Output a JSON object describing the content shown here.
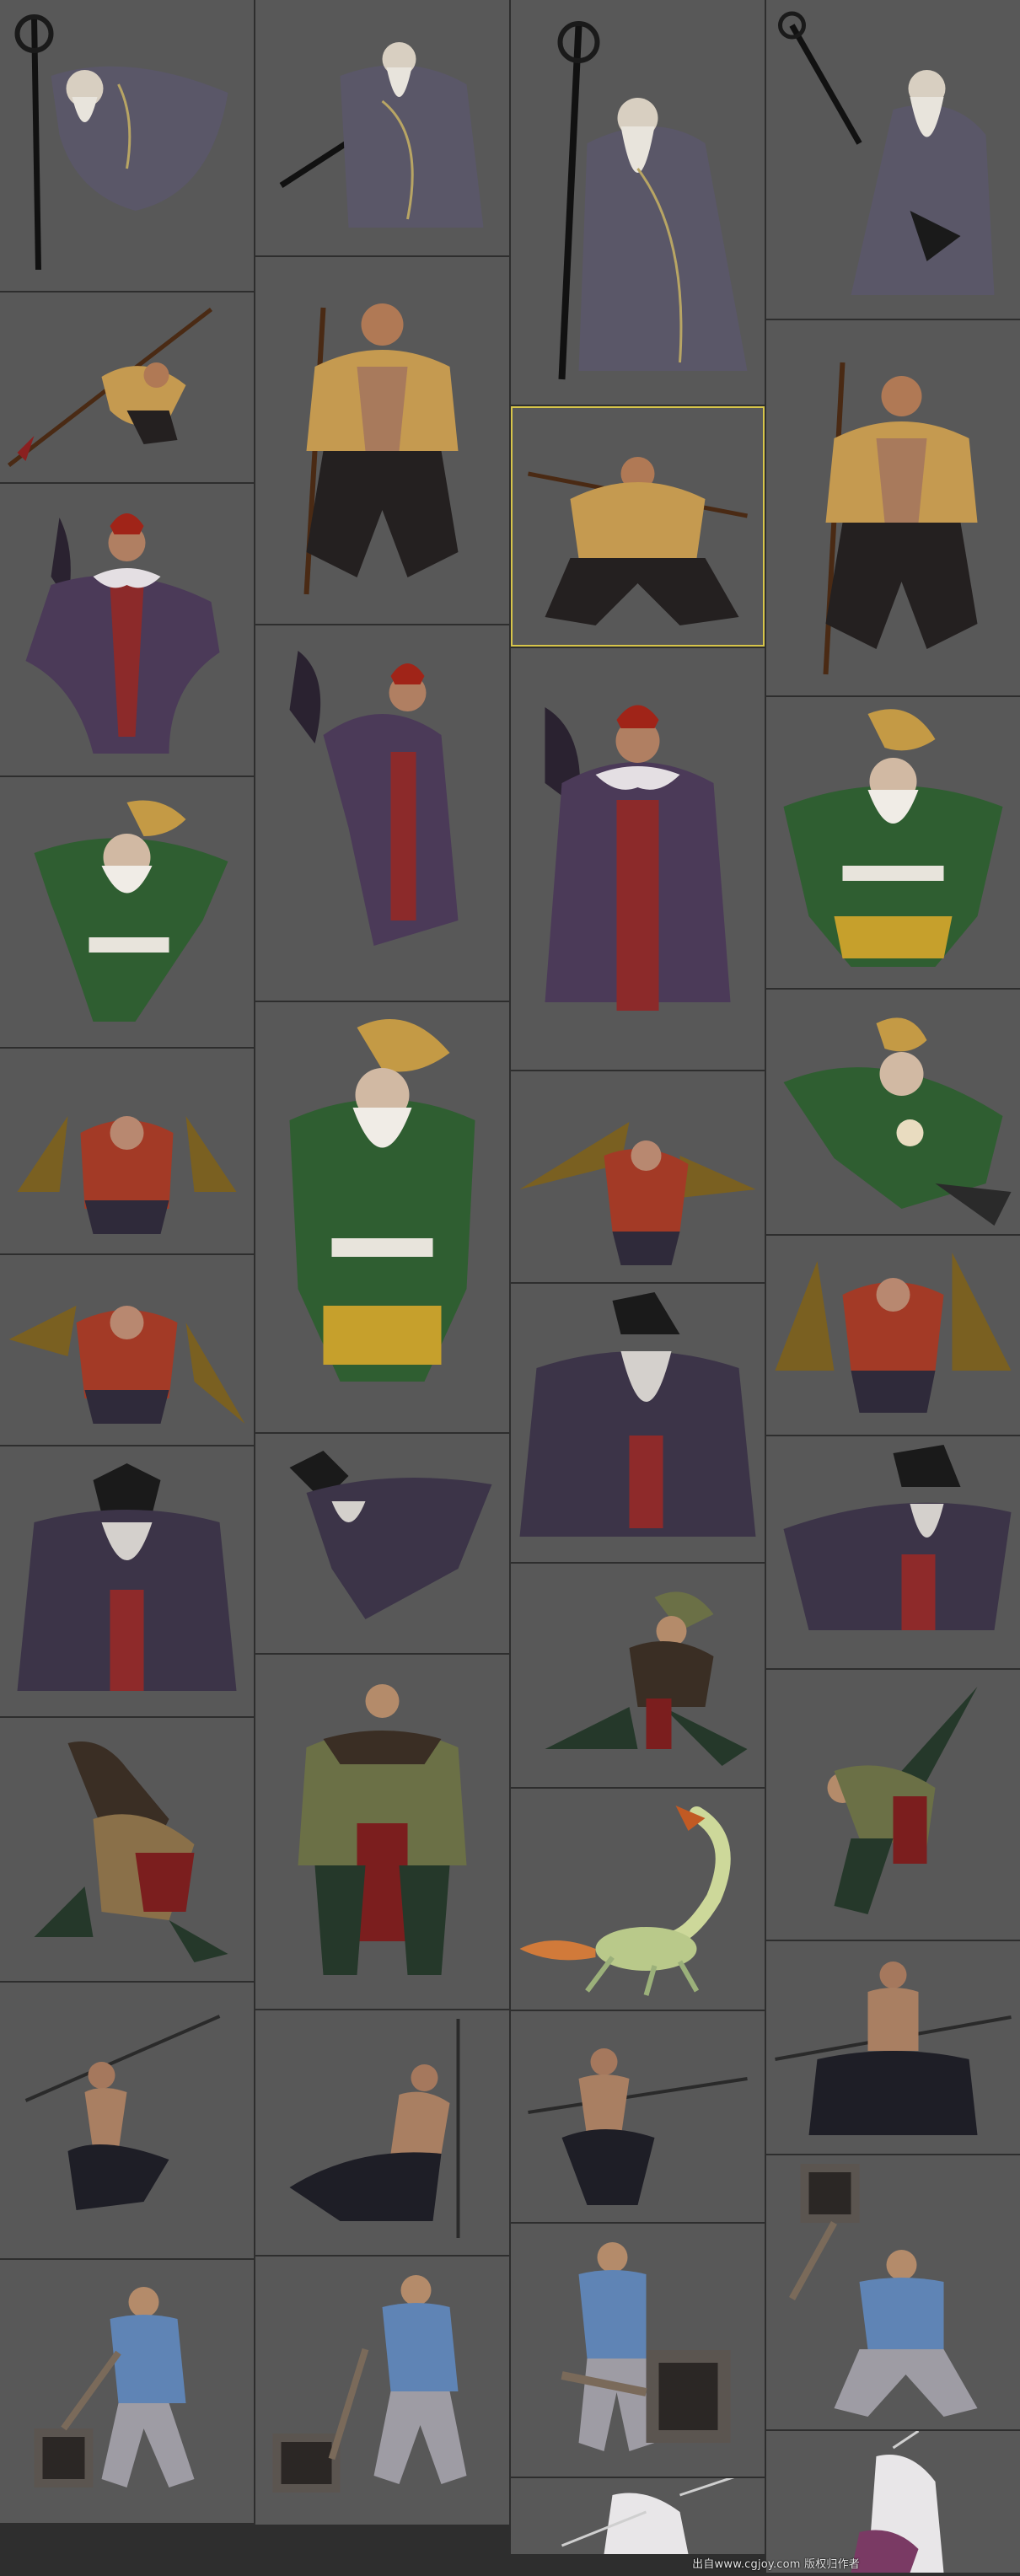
{
  "watermark": "出自www.cgjoy.com 版权归作者",
  "colors": {
    "background": "#585858",
    "gutter": "#2e2e2e",
    "highlight": "#d7c54a"
  },
  "columns": [
    {
      "tiles": [
        {
          "name": "tile-old-sage-staff-flying",
          "figure": "sage"
        },
        {
          "name": "tile-bandit-spear-lunge",
          "figure": "bandit"
        },
        {
          "name": "tile-fan-mage-red-hair",
          "figure": "fanmage"
        },
        {
          "name": "tile-monk-green-robe-leaping",
          "figure": "monk"
        },
        {
          "name": "tile-drill-warrior-front-1",
          "figure": "drill"
        },
        {
          "name": "tile-drill-warrior-front-2",
          "figure": "drill"
        },
        {
          "name": "tile-dark-robed-sorcerer-1",
          "figure": "sorcerer"
        },
        {
          "name": "tile-archer-crouch",
          "figure": "archer"
        },
        {
          "name": "tile-spearman-dancing",
          "figure": "spearman"
        },
        {
          "name": "tile-hammer-fighter-blue-1",
          "figure": "hammer"
        }
      ]
    },
    {
      "tiles": [
        {
          "name": "tile-old-sage-staff-side",
          "figure": "sage"
        },
        {
          "name": "tile-bandit-standing-front",
          "figure": "bandit"
        },
        {
          "name": "tile-fan-mage-side",
          "figure": "fanmage"
        },
        {
          "name": "tile-monk-green-robe-front",
          "figure": "monk"
        },
        {
          "name": "tile-dark-robed-sorcerer-leap",
          "figure": "sorcerer"
        },
        {
          "name": "tile-archer-standing-front",
          "figure": "archer"
        },
        {
          "name": "tile-spearman-kneeling",
          "figure": "spearman"
        },
        {
          "name": "tile-hammer-fighter-blue-2",
          "figure": "hammer"
        }
      ]
    },
    {
      "tiles": [
        {
          "name": "tile-old-sage-staff-upright",
          "figure": "sage"
        },
        {
          "name": "tile-bandit-crouching",
          "figure": "bandit",
          "active": true
        },
        {
          "name": "tile-fan-mage-front",
          "figure": "fanmage"
        },
        {
          "name": "tile-drill-warrior-side",
          "figure": "drill"
        },
        {
          "name": "tile-dark-robed-sorcerer-2",
          "figure": "sorcerer"
        },
        {
          "name": "tile-archer-lunge",
          "figure": "archer"
        },
        {
          "name": "tile-scorpion-creature",
          "figure": "scorpion"
        },
        {
          "name": "tile-spearman-thrust",
          "figure": "spearman"
        },
        {
          "name": "tile-hammer-fighter-blue-3",
          "figure": "hammer"
        },
        {
          "name": "tile-white-haired-figure-partial-1",
          "figure": "whitehair"
        }
      ]
    },
    {
      "tiles": [
        {
          "name": "tile-old-sage-back",
          "figure": "sage"
        },
        {
          "name": "tile-bandit-standing-staff",
          "figure": "bandit"
        },
        {
          "name": "tile-monk-green-robe-stance",
          "figure": "monk"
        },
        {
          "name": "tile-monk-green-robe-tumble",
          "figure": "monk"
        },
        {
          "name": "tile-drill-warrior-front-3",
          "figure": "drill"
        },
        {
          "name": "tile-dark-robed-sorcerer-3",
          "figure": "sorcerer"
        },
        {
          "name": "tile-archer-kick",
          "figure": "archer"
        },
        {
          "name": "tile-spearman-stance",
          "figure": "spearman"
        },
        {
          "name": "tile-hammer-fighter-blue-4",
          "figure": "hammer"
        },
        {
          "name": "tile-white-haired-figure-partial-2",
          "figure": "whitehair"
        }
      ]
    }
  ]
}
